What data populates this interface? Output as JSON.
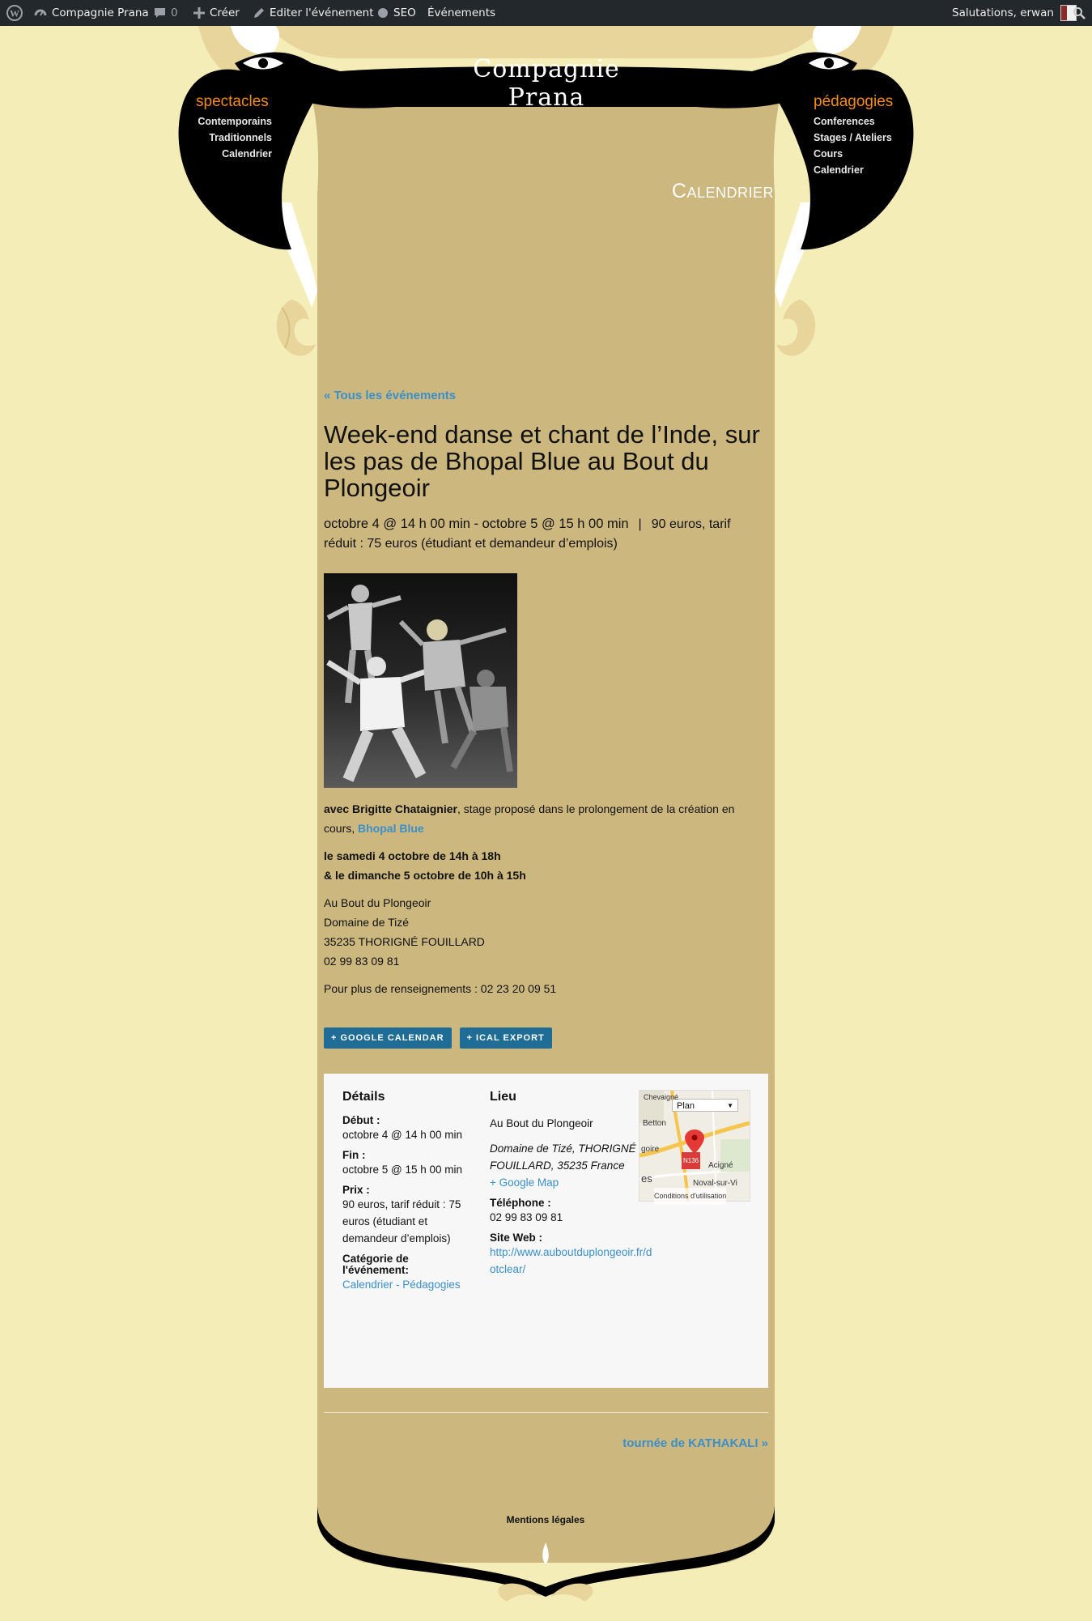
{
  "adminbar": {
    "site_name": "Compagnie Prana",
    "comments_count": "0",
    "create_label": "Créer",
    "edit_label": "Editer l'événement",
    "seo_label": "SEO",
    "events_label": "Événements",
    "greeting": "Salutations, erwan"
  },
  "site": {
    "logo": "Compagnie Prana"
  },
  "menu_left": {
    "title": "spectacles",
    "items": [
      "Contemporains",
      "Traditionnels",
      "Calendrier"
    ]
  },
  "menu_right": {
    "title": "pédagogies",
    "items": [
      "Conferences",
      "Stages / Ateliers",
      "Cours",
      "Calendrier"
    ]
  },
  "page_heading": "Calendrier",
  "event": {
    "back_link": "« Tous les événements",
    "title": "Week-end danse et chant de l’Inde, sur les pas de Bhopal Blue au Bout du Plongeoir",
    "dates": "octobre 4 @ 14 h 00 min - octobre 5 @ 15 h 00 min",
    "separator": "|",
    "price_first": "90 euros, tarif",
    "price_rest": "réduit : 75 euros (étudiant et demandeur d’emplois)",
    "intro_bold": "avec Brigitte Chataignier",
    "intro_text": ", stage proposé dans le prolongement de la création en cours, ",
    "intro_link": "Bhopal Blue",
    "schedule_line1": "le samedi 4 octobre de 14h à 18h",
    "schedule_line2": "& le dimanche 5 octobre de 10h à 15h",
    "address": [
      "Au Bout du Plongeoir",
      "Domaine de Tizé",
      "35235 THORIGNÉ FOUILLARD",
      "02 99 83 09 81"
    ],
    "info": "Pour plus de renseignements : 02 23 20 09 51",
    "btn_google": "+ GOOGLE CALENDAR",
    "btn_ical": "+ ICAL EXPORT"
  },
  "meta": {
    "details_title": "Détails",
    "start_label": "Début :",
    "start_value": "octobre 4 @ 14 h 00 min",
    "end_label": "Fin :",
    "end_value": "octobre 5 @ 15 h 00 min",
    "price_label": "Prix :",
    "price_value": "90 euros, tarif réduit : 75 euros (étudiant et demandeur d’emplois)",
    "category_label": "Catégorie de l'événement:",
    "category_value": "Calendrier - Pédagogies",
    "venue_title": "Lieu",
    "venue_name": "Au Bout du Plongeoir",
    "venue_address": "Domaine de Tizé, THORIGNÉ FOUILLARD, 35235 France",
    "google_map": "+ Google Map",
    "phone_label": "Téléphone :",
    "phone_value": "02 99 83 09 81",
    "website_label": "Site Web :",
    "website_value": "http://www.auboutduplongeoir.fr/dotclear/",
    "map": {
      "dropdown": "Plan",
      "labels": [
        "Chevaigné",
        "Betton",
        "goire",
        "es",
        "Acigné",
        "Noval-sur-Vi",
        "N136"
      ],
      "terms": "Conditions d'utilisation"
    }
  },
  "nav": {
    "next": "tournée de KATHAKALI »"
  },
  "footer": {
    "legal": "Mentions légales"
  },
  "colors": {
    "parchment": "#ccb77f",
    "background": "#f5edb8",
    "accent_orange": "#f28c1a",
    "link_blue": "#3b8fc9",
    "button_blue": "#1f6d97"
  }
}
